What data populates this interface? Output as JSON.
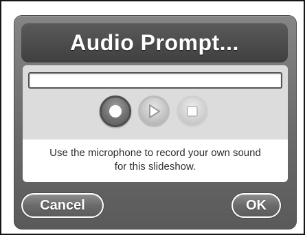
{
  "dialog": {
    "title": "Audio Prompt...",
    "audio_name_value": "",
    "controls": {
      "record_icon": "record-icon",
      "play_icon": "play-icon",
      "stop_icon": "stop-icon"
    },
    "description_line1": "Use the microphone to record your own sound",
    "description_line2": "for this slideshow.",
    "cancel_label": "Cancel",
    "ok_label": "OK"
  }
}
